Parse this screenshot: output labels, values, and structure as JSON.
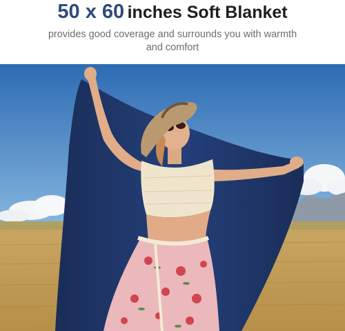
{
  "header": {
    "title_numbers": "50 x 60",
    "title_rest": "inches Soft Blanket",
    "subtitle": "provides good coverage and surrounds you with warmth and comfort"
  },
  "photo": {
    "subject": "woman-holding-blanket",
    "colors": {
      "sky_top": "#2f6fb6",
      "sky_bottom": "#7fb0db",
      "field": "#c8a25a",
      "blanket": "#1f3566",
      "top": "#efe6cf",
      "skirt": "#e8b3b7",
      "hat": "#b99a70",
      "skin": "#e2b08c"
    }
  }
}
